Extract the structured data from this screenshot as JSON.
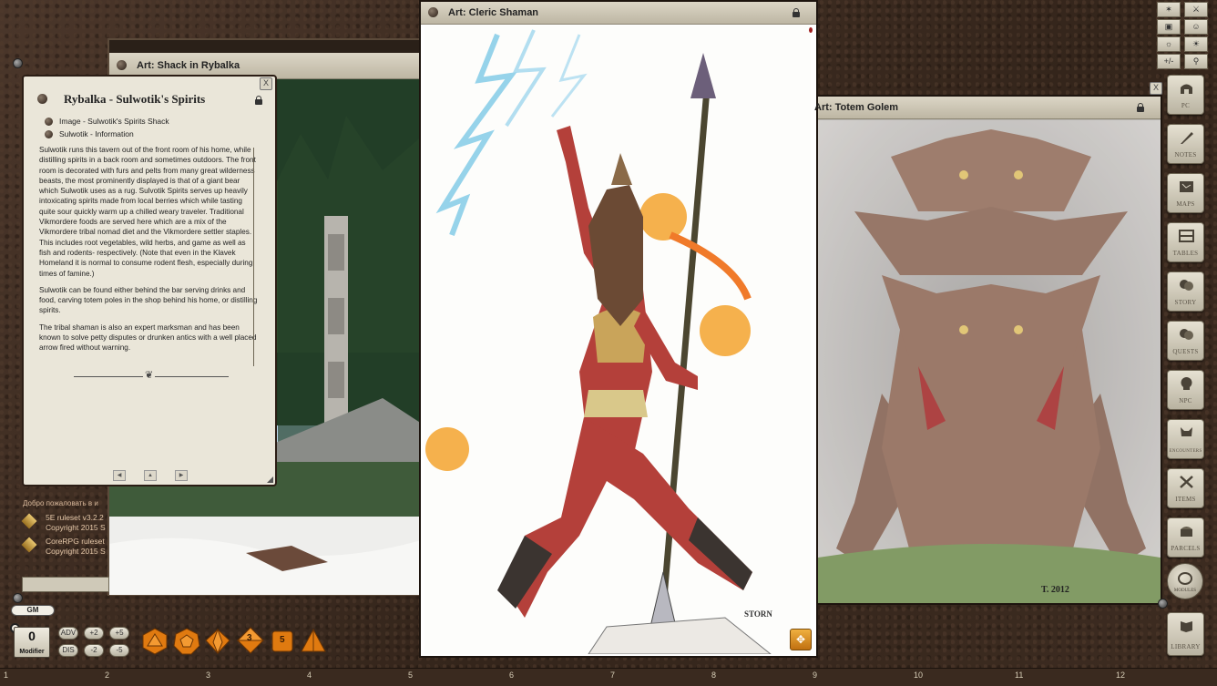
{
  "windows": {
    "shack": {
      "title": "Art: Shack in Rybalka"
    },
    "shaman": {
      "title": "Art: Cleric Shaman",
      "signature": "STORN"
    },
    "golem": {
      "title": "Art: Totem Golem",
      "signature": "T. 2012"
    },
    "story": {
      "title": "Rybalka - Sulwotik's Spirits",
      "links": [
        "Image - Sulwotik's Spirits Shack",
        "Sulwotik - Information"
      ],
      "paragraphs": [
        "Sulwotik runs this tavern out of the front room of his home, while distilling spirits in a back room and sometimes outdoors. The front room is decorated with furs and pelts from many great wilderness beasts, the most prominently displayed is that of a giant bear which Sulwotik uses as a rug. Sulvotik Spirits serves up heavily intoxicating spirits made from local berries which while tasting quite sour quickly warm up a chilled weary traveler. Traditional Vikmordere foods are served here which are a mix of the Vikmordere tribal nomad diet and the Vikmordere settler staples. This includes root vegetables, wild herbs, and game as well as fish and rodents- respectively. (Note that even in the Klavek Homeland it is normal to consume rodent flesh, especially during times of famine.)",
        "Sulwotik can be found either behind the bar serving drinks and food, carving totem poles in the shop behind his home, or distilling spirits.",
        "The tribal shaman is also an expert marksman and has been known to solve petty disputes or drunken antics with a well placed arrow fired without warning."
      ]
    }
  },
  "chat": {
    "welcome": "Добро пожаловать в и",
    "entries": [
      {
        "line1": "5E ruleset v3.2.2",
        "line2": "Copyright 2015 S"
      },
      {
        "line1": "CoreRPG ruleset",
        "line2": "Copyright 2015 S"
      }
    ]
  },
  "gm_label": "GM",
  "modifier": {
    "value": "0",
    "label": "Modifier"
  },
  "mod_buttons": [
    "ADV",
    "+2",
    "+5",
    "DIS",
    "-2",
    "-5"
  ],
  "dice": [
    {
      "icon": "d20-icon",
      "color": "#e07a10"
    },
    {
      "icon": "d12-icon",
      "color": "#e07a10"
    },
    {
      "icon": "d10-icon",
      "color": "#e07a10"
    },
    {
      "icon": "d8-icon",
      "value": "3",
      "color": "#e07a10"
    },
    {
      "icon": "d6-icon",
      "value": "5",
      "color": "#e07a10"
    },
    {
      "icon": "d4-icon",
      "color": "#e07a10"
    }
  ],
  "toolbar": [
    "+/-"
  ],
  "sidebar": [
    {
      "label": "PC",
      "icon": "helmet-icon"
    },
    {
      "label": "NOTES",
      "icon": "quill-icon"
    },
    {
      "label": "MAPS",
      "icon": "map-icon"
    },
    {
      "label": "TABLES",
      "icon": "table-icon"
    },
    {
      "label": "STORY",
      "icon": "masks-icon"
    },
    {
      "label": "QUESTS",
      "icon": "masks-icon"
    },
    {
      "label": "NPC",
      "icon": "skull-icon"
    },
    {
      "label": "ENCOUNTERS",
      "icon": "demon-icon"
    },
    {
      "label": "ITEMS",
      "icon": "swords-icon"
    },
    {
      "label": "PARCELS",
      "icon": "treasure-icon"
    },
    {
      "label": "MODULES",
      "icon": "module-icon"
    },
    {
      "label": "LIBRARY",
      "icon": "book-icon"
    }
  ],
  "ruler": [
    "1",
    "2",
    "3",
    "4",
    "5",
    "6",
    "7",
    "8",
    "9",
    "10",
    "11",
    "12"
  ],
  "colors": {
    "accent": "#e07a10",
    "parchment": "#e9e5d8",
    "frame": "#2b1d15"
  }
}
